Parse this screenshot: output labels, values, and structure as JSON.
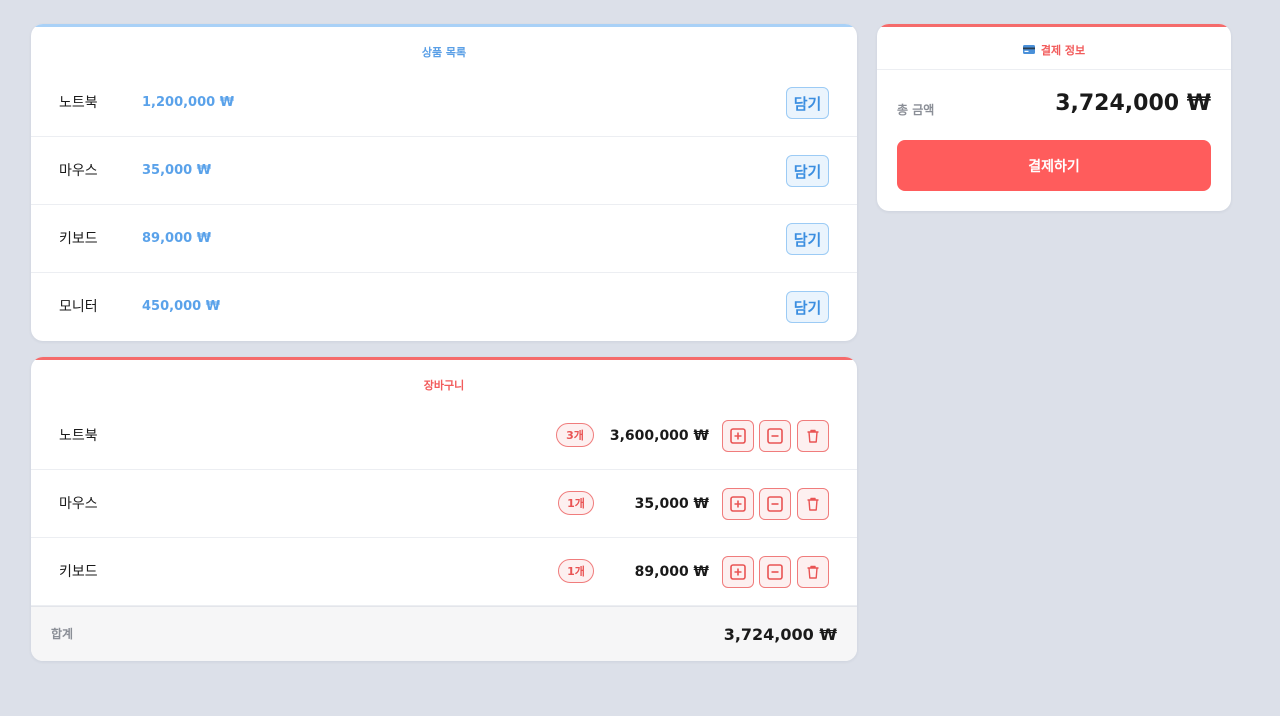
{
  "products": {
    "title": "상품 목록",
    "add_label": "담기",
    "items": [
      {
        "name": "노트북",
        "price": "1,200,000 ₩"
      },
      {
        "name": "마우스",
        "price": "35,000 ₩"
      },
      {
        "name": "키보드",
        "price": "89,000 ₩"
      },
      {
        "name": "모니터",
        "price": "450,000 ₩"
      }
    ]
  },
  "cart": {
    "title": "장바구니",
    "items": [
      {
        "name": "노트북",
        "qty": "3개",
        "total": "3,600,000 ₩"
      },
      {
        "name": "마우스",
        "qty": "1개",
        "total": "35,000 ₩"
      },
      {
        "name": "키보드",
        "qty": "1개",
        "total": "89,000 ₩"
      }
    ],
    "footer_label": "합계",
    "footer_total": "3,724,000 ₩"
  },
  "checkout": {
    "title": "결제 정보",
    "total_label": "총 금액",
    "total_value": "3,724,000 ₩",
    "pay_label": "결제하기"
  },
  "colors": {
    "background": "#dce0e9",
    "blue_accent": "#5a9fe6",
    "red_accent": "#ff5c5c",
    "card": "#ffffff"
  },
  "icons": {
    "increase": "plus-square-icon",
    "decrease": "minus-square-icon",
    "remove": "trash-icon",
    "checkout": "credit-card-icon"
  }
}
